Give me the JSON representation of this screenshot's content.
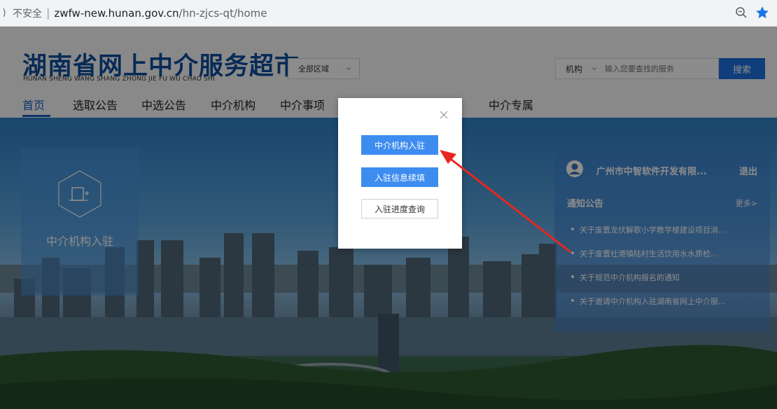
{
  "browser": {
    "back_glyph": ")",
    "security_label": "不安全",
    "url_host": "zwfw-new.hunan.gov.cn",
    "url_path": "/hn-zjcs-qt/home"
  },
  "site": {
    "title": "湖南省网上中介服务超市",
    "subtitle": "HUNAN SHENG WANG SHANG ZHONG JIE FU WU CHAO SHI"
  },
  "region_select": {
    "value": "全部区域"
  },
  "search": {
    "type": "机构",
    "placeholder": "输入您要查找的服务",
    "button_label": "搜索"
  },
  "nav": {
    "items": [
      {
        "label": "首页"
      },
      {
        "label": "选取公告"
      },
      {
        "label": "中选公告"
      },
      {
        "label": "中介机构"
      },
      {
        "label": "中介事项"
      },
      {
        "label": "中介专属"
      }
    ],
    "active_index": 0
  },
  "left_card": {
    "label": "中介机构入驻"
  },
  "right_card": {
    "company": "广州市中智软件开发有限...",
    "logout": "退出",
    "notice_title": "通知公告",
    "more": "更多>",
    "notices": [
      "关于废置龙伏解歌小学教学楼建设项目消...",
      "关于废置社港镇陆村生活饮用水水质检...",
      "关于规范中介机构报名的通知",
      "关于邀请中介机构入驻湖南省网上中介服..."
    ]
  },
  "modal": {
    "btn_register": "中介机构入驻",
    "btn_renew": "入驻信息续填",
    "btn_progress": "入驻进度查询"
  },
  "colors": {
    "brand_blue": "#0d4e9e",
    "primary_button": "#3d8cf0",
    "annotation_arrow": "#e8261f"
  }
}
